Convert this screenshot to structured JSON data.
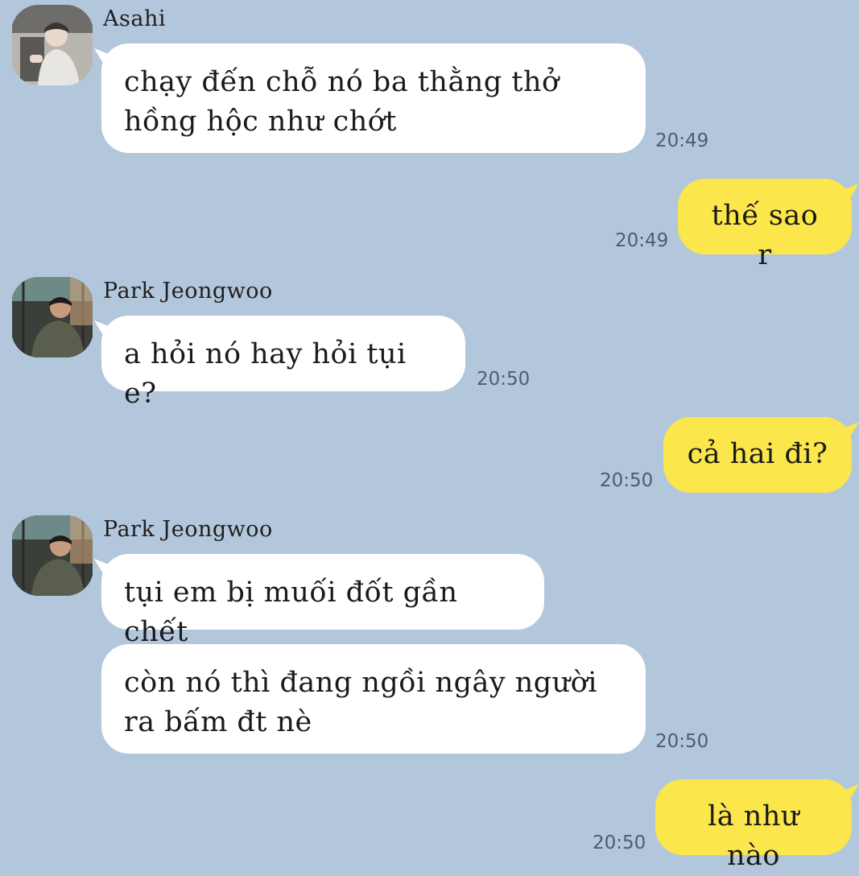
{
  "messages": [
    {
      "sender": "Asahi",
      "text_lines": [
        "chạy đến chỗ nó ba thằng thở",
        "hồng hộc như chớt"
      ],
      "time": "20:49"
    },
    {
      "text": "thế sao r",
      "time": "20:49"
    },
    {
      "sender": "Park Jeongwoo",
      "text": "a hỏi nó hay hỏi tụi e?",
      "time": "20:50"
    },
    {
      "text": "cả hai đi?",
      "time": "20:50"
    },
    {
      "sender": "Park Jeongwoo",
      "text": "tụi em bị muối đốt gần chết"
    },
    {
      "text_lines": [
        "còn nó thì đang ngồi ngây người",
        "ra bấm đt nè"
      ],
      "time": "20:50"
    },
    {
      "text": "là như nào",
      "time": "20:50"
    }
  ],
  "colors": {
    "background": "#b3c7dc",
    "incoming_bubble": "#ffffff",
    "outgoing_bubble": "#fbe64b"
  },
  "avatars": {
    "asahi": "avatar-asahi",
    "jeongwoo": "avatar-park-jeongwoo"
  }
}
